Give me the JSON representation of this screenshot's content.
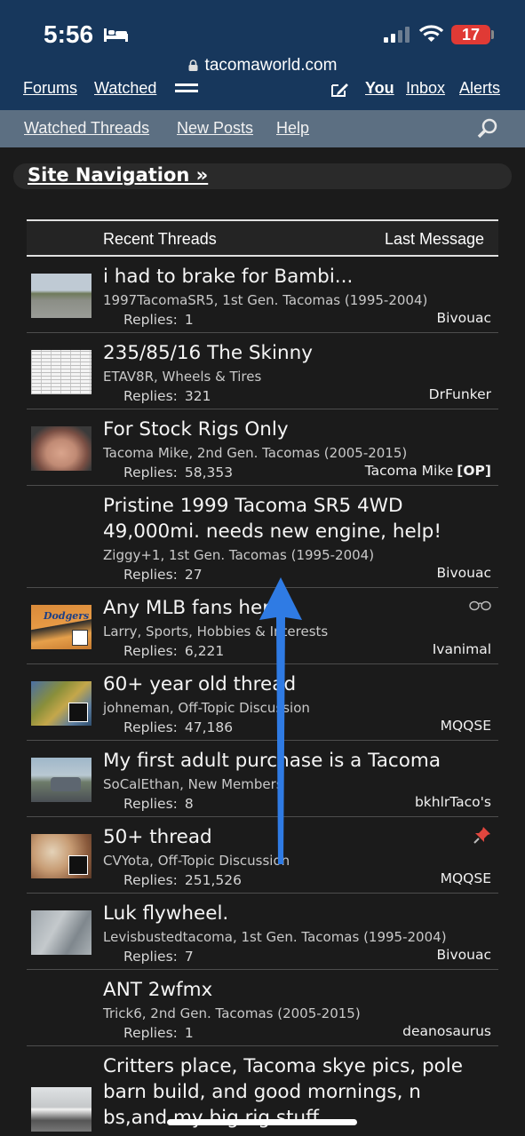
{
  "status_bar": {
    "time": "5:56",
    "battery": "17",
    "url": "tacomaworld.com"
  },
  "top_nav": {
    "forums": "Forums",
    "watched": "Watched",
    "you": "You",
    "inbox": "Inbox",
    "alerts": "Alerts"
  },
  "sub_nav": {
    "watched_threads": "Watched Threads",
    "new_posts": "New Posts",
    "help": "Help"
  },
  "site_nav": {
    "label": "Site Navigation »"
  },
  "table": {
    "header_left": "Recent Threads",
    "header_right": "Last Message",
    "replies_label": "Replies:",
    "op_tag": "[OP]",
    "rows": [
      {
        "title": "i had to brake for Bambi...",
        "meta": "1997TacomaSR5, 1st Gen. Tacomas (1995-2004)",
        "replies": "1",
        "last_user": "Bivouac",
        "thumb": "road"
      },
      {
        "title": "235/85/16 The Skinny",
        "meta": "ETAV8R, Wheels & Tires",
        "replies": "321",
        "last_user": "DrFunker",
        "thumb": "spreadsheet"
      },
      {
        "title": "For Stock Rigs Only",
        "meta": "Tacoma Mike, 2nd Gen. Tacomas (2005-2015)",
        "replies": "58,353",
        "last_user": "Tacoma Mike",
        "is_op": true,
        "thumb": "face"
      },
      {
        "title": "Pristine 1999 Tacoma SR5 4WD 49,000mi. needs new engine, help!",
        "meta": "Ziggy+1, 1st Gen. Tacomas (1995-2004)",
        "replies": "27",
        "last_user": "Bivouac",
        "thumb": "none"
      },
      {
        "title": "Any MLB fans here",
        "meta": "Larry, Sports, Hobbies & Interests",
        "replies": "6,221",
        "last_user": "Ivanimal",
        "thumb": "dodgers",
        "icon": "sunglasses-icon"
      },
      {
        "title": "60+ year old thread",
        "meta": "johneman, Off-Topic Discussion",
        "replies": "47,186",
        "last_user": "MQQSE",
        "thumb": "colorful"
      },
      {
        "title": "My first adult purchase is a Tacoma",
        "meta": "SoCalEthan, New Members",
        "replies": "8",
        "last_user": "bkhlrTaco's",
        "thumb": "truck"
      },
      {
        "title": "50+ thread",
        "meta": "CVYota, Off-Topic Discussion",
        "replies": "251,526",
        "last_user": "MQQSE",
        "thumb": "skull",
        "icon": "pin-icon"
      },
      {
        "title": "Luk flywheel.",
        "meta": "Levisbustedtacoma, 1st Gen. Tacomas (1995-2004)",
        "replies": "7",
        "last_user": "Bivouac",
        "thumb": "metal"
      },
      {
        "title": "ANT 2wfmx",
        "meta": "Trick6, 2nd Gen. Tacomas (2005-2015)",
        "replies": "1",
        "last_user": "deanosaurus",
        "thumb": "none"
      },
      {
        "title": "Critters place, Tacoma skye pics, pole barn build, and good mornings, n bs,and my big rig stuff",
        "meta": "",
        "replies": "",
        "last_user": "",
        "thumb": "jeep"
      }
    ]
  },
  "colors": {
    "header_blue": "#17375c",
    "subnav_gray": "#5c6f82",
    "background": "#1b1b1b",
    "arrow_blue": "#2f7be4",
    "battery_red": "#e03a35"
  }
}
